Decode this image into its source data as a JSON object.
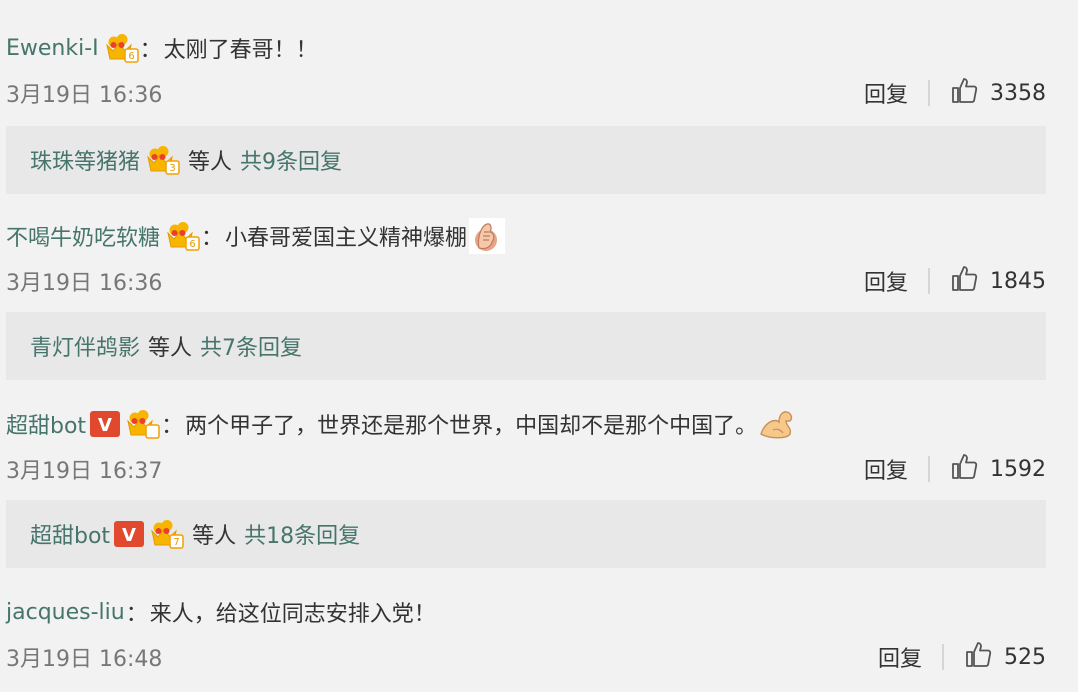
{
  "comments": [
    {
      "username": "Ewenki-I",
      "level": "6",
      "text": "太刚了春哥！！",
      "time": "3月19日 16:36",
      "reply_label": "回复",
      "likes": "3358",
      "reply_preview": {
        "user": "珠珠等猪猪",
        "level": "3",
        "etc": "等人",
        "total": "共9条回复"
      }
    },
    {
      "username": "不喝牛奶吃软糖",
      "level": "6",
      "text": "小春哥爱国主义精神爆棚",
      "time": "3月19日 16:36",
      "reply_label": "回复",
      "likes": "1845",
      "reply_preview": {
        "user": "青灯伴鸪影",
        "etc": "等人",
        "total": "共7条回复"
      }
    },
    {
      "username": "超甜bot",
      "level": "",
      "vip": "V",
      "text": "两个甲子了，世界还是那个世界，中国却不是那个中国了。",
      "time": "3月19日 16:37",
      "reply_label": "回复",
      "likes": "1592",
      "reply_preview": {
        "user": "超甜bot",
        "vip": "V",
        "level": "7",
        "etc": "等人",
        "total": "共18条回复"
      }
    },
    {
      "username": "jacques-liu",
      "text": "来人，给这位同志安排入党！",
      "time": "3月19日 16:48",
      "reply_label": "回复",
      "likes": "525"
    }
  ],
  "colors": {
    "username": "#46756b",
    "background": "#f2f2f2",
    "reply_box": "#e8e8e8",
    "crown": "#f5b800",
    "vip_badge": "#e0492d"
  },
  "icons": [
    "crown-level-icon",
    "vip-v-icon",
    "thumbs-up-icon",
    "facepalm-emoji-icon",
    "flexed-bicep-emoji-icon"
  ]
}
